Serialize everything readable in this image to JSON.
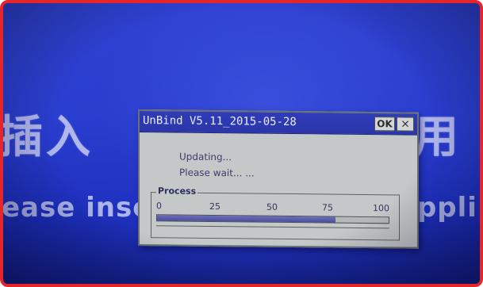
{
  "background": {
    "cjk_left": "插入",
    "cjk_right": "用",
    "en_left": "ease inse",
    "en_right": "appli",
    "screen_color": "#2a3fd0"
  },
  "dialog": {
    "title": "UnBind V5.11_2015-05-28",
    "ok_label": "OK",
    "close_label": "×",
    "status_line1": "Updating...",
    "status_line2": "Please  wait... ...",
    "process": {
      "legend": "Process",
      "ticks": [
        "0",
        "25",
        "50",
        "75",
        "100"
      ],
      "progress_fraction": 0.77
    }
  },
  "colors": {
    "titlebar": "#2b36a9",
    "dialog_face": "#c4c8c8",
    "progress": "#4a4f9e",
    "frame_border": "#e4262b"
  }
}
